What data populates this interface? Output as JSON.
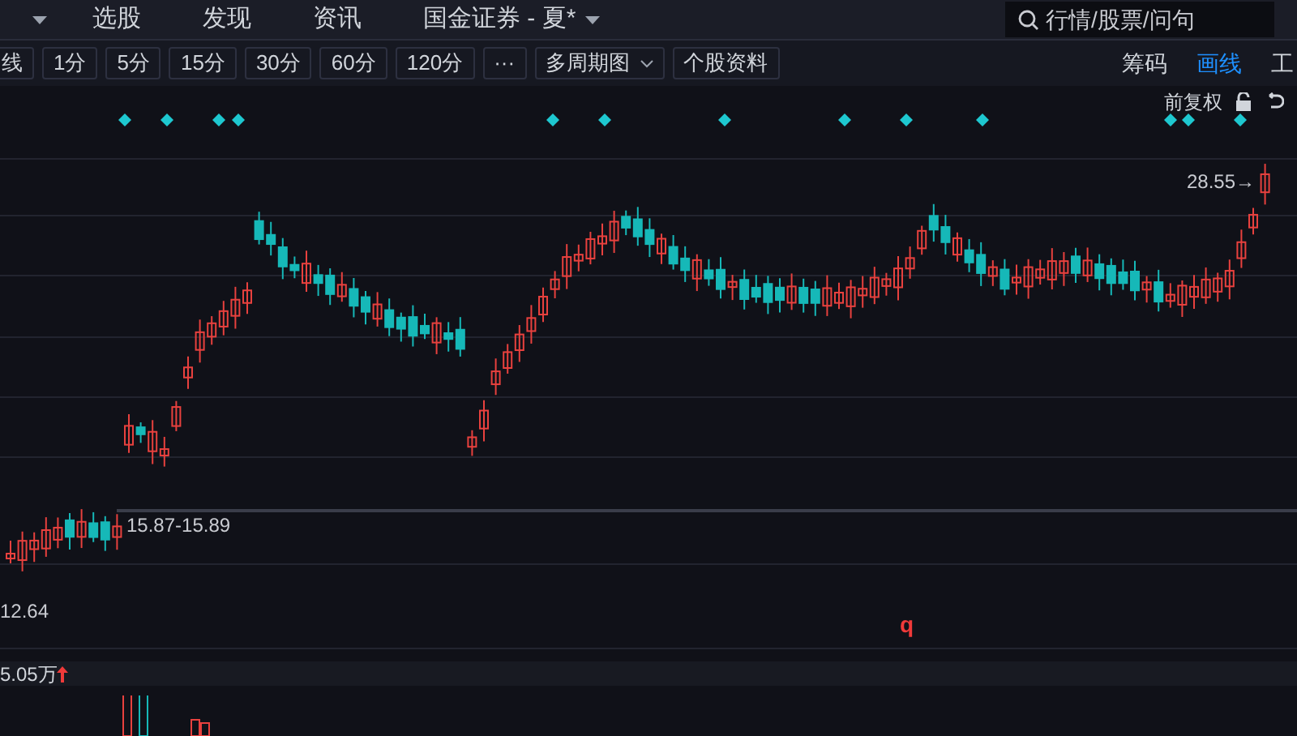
{
  "top_bar": {
    "items": [
      {
        "label": "选股",
        "dropdown": false
      },
      {
        "label": "发现",
        "dropdown": false
      },
      {
        "label": "资讯",
        "dropdown": false
      },
      {
        "label": "国金证券 - 夏*",
        "dropdown": true
      }
    ],
    "search": {
      "placeholder": "行情/股票/问句"
    }
  },
  "toolbar": {
    "periods": [
      {
        "label": "线",
        "kind": "button"
      },
      {
        "label": "1分",
        "kind": "button"
      },
      {
        "label": "5分",
        "kind": "button"
      },
      {
        "label": "15分",
        "kind": "button"
      },
      {
        "label": "30分",
        "kind": "button"
      },
      {
        "label": "60分",
        "kind": "button"
      },
      {
        "label": "120分",
        "kind": "button"
      },
      {
        "label": "···",
        "kind": "button"
      },
      {
        "label": "多周期图",
        "kind": "dropdown"
      },
      {
        "label": "个股资料",
        "kind": "button"
      }
    ],
    "tabs": [
      {
        "label": "筹码",
        "selected": false
      },
      {
        "label": "画线",
        "selected": true
      },
      {
        "label": "工",
        "selected": false
      }
    ]
  },
  "chart": {
    "adjust_label": "前复权",
    "high_label": "28.55→",
    "range_label": "15.87-15.89",
    "low_label": "12.64",
    "marker": "q"
  },
  "volume": {
    "label": "5.05万",
    "rising": true
  }
}
